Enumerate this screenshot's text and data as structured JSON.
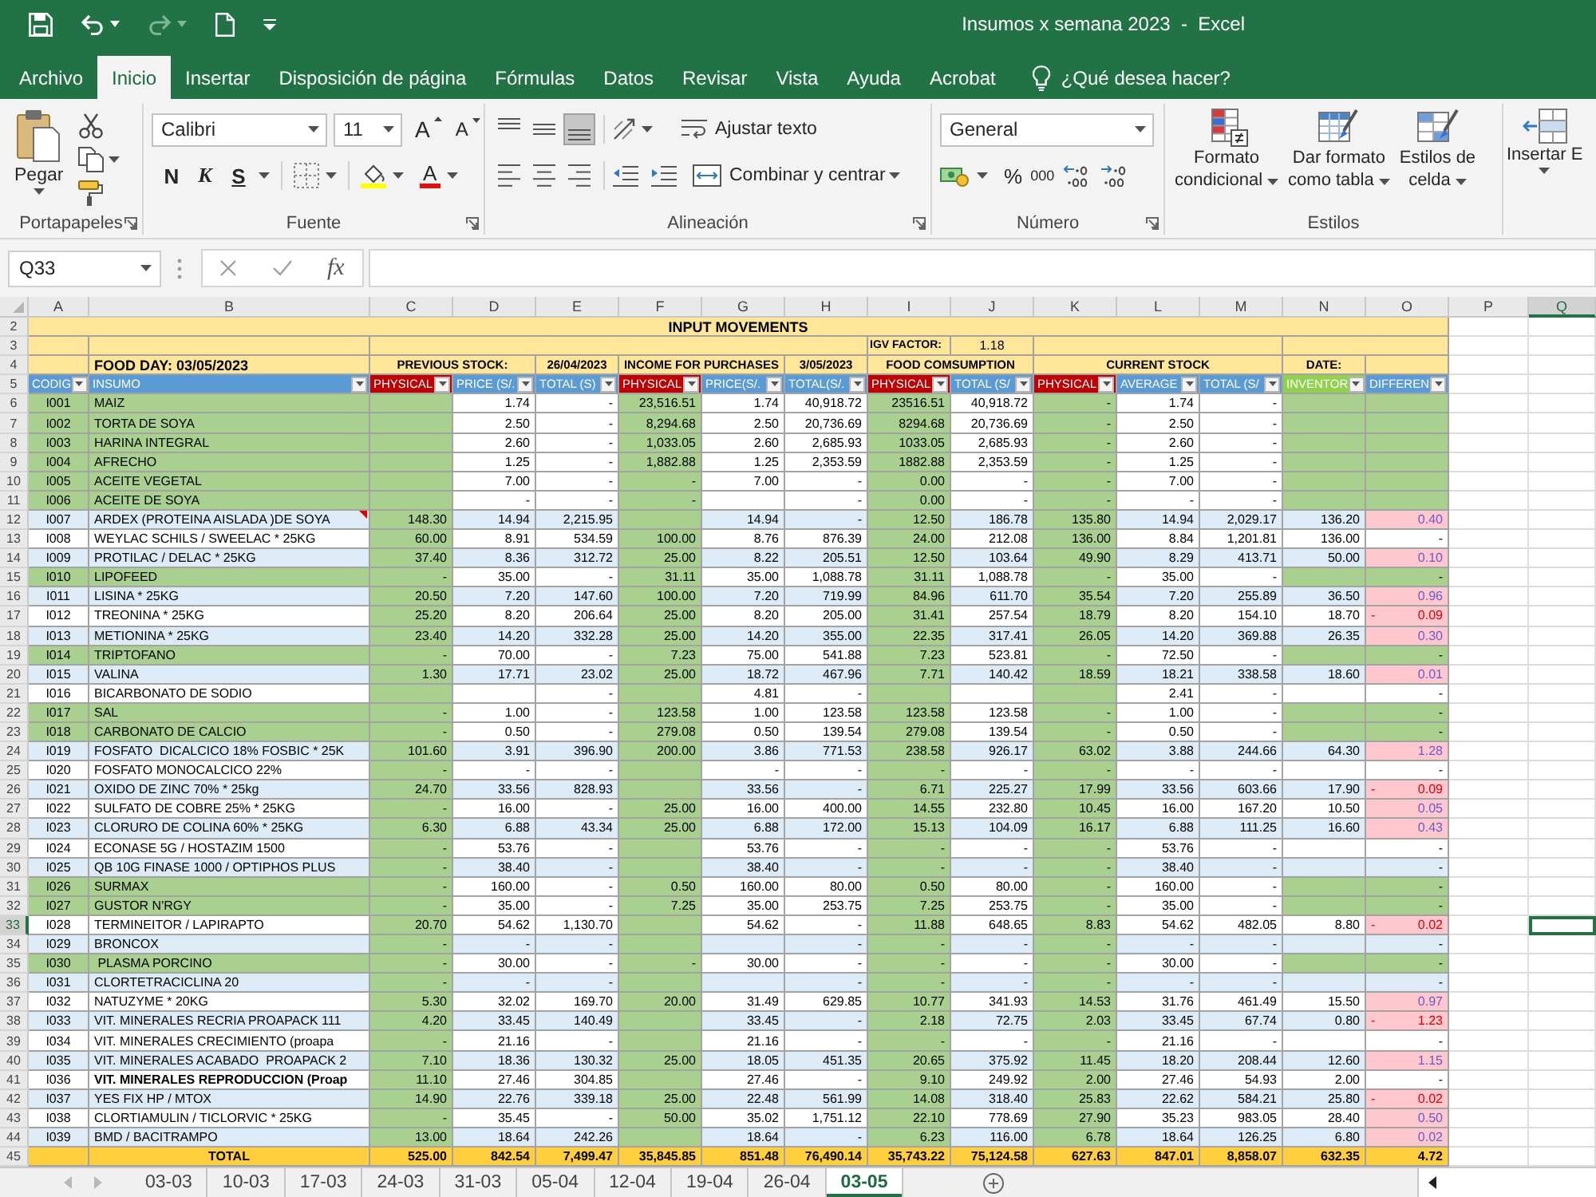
{
  "window": {
    "title": "Insumos x semana 2023  -  Excel"
  },
  "ribbon_tabs": [
    {
      "label": "Archivo",
      "selected": false
    },
    {
      "label": "Inicio",
      "selected": true
    },
    {
      "label": "Insertar",
      "selected": false
    },
    {
      "label": "Disposición de página",
      "selected": false
    },
    {
      "label": "Fórmulas",
      "selected": false
    },
    {
      "label": "Datos",
      "selected": false
    },
    {
      "label": "Revisar",
      "selected": false
    },
    {
      "label": "Vista",
      "selected": false
    },
    {
      "label": "Ayuda",
      "selected": false
    },
    {
      "label": "Acrobat",
      "selected": false
    }
  ],
  "tell_me": {
    "placeholder": "¿Qué desea hacer?"
  },
  "ribbon": {
    "clipboard": {
      "paste": "Pegar",
      "label": "Portapapeles"
    },
    "font": {
      "name": "Calibri",
      "size": "11",
      "grow_font_button": "A",
      "shrink_font_button": "A",
      "bold_button": "N",
      "italic_button": "K",
      "underline_button": "S",
      "font_color_button": "A",
      "label": "Fuente"
    },
    "alignment": {
      "vertical": [
        {
          "kind": "top",
          "selected": false
        },
        {
          "kind": "middle",
          "selected": false
        },
        {
          "kind": "bottom",
          "selected": true
        }
      ],
      "horizontal": [
        {
          "kind": "left",
          "selected": false
        },
        {
          "kind": "center",
          "selected": false
        },
        {
          "kind": "right",
          "selected": false
        }
      ],
      "wrap_text": "Ajustar texto",
      "merge": "Combinar y centrar",
      "label": "Alineación"
    },
    "number": {
      "format": "General",
      "percent": "%",
      "thousands": "000",
      "label": "Número"
    },
    "styles": {
      "buttons": [
        {
          "kind": "conditional",
          "lines": [
            "Formato",
            "condicional"
          ]
        },
        {
          "kind": "table",
          "lines": [
            "Dar formato",
            "como tabla"
          ]
        },
        {
          "kind": "cell",
          "lines": [
            "Estilos de",
            "celda"
          ]
        }
      ],
      "label": "Estilos"
    },
    "cells": {
      "insert": "Insertar E"
    }
  },
  "formula_bar": {
    "name_box": "Q33",
    "function": "fx"
  },
  "sheet": {
    "columns": [
      {
        "label": "A",
        "selected": false
      },
      {
        "label": "B",
        "selected": false
      },
      {
        "label": "C",
        "selected": false
      },
      {
        "label": "D",
        "selected": false
      },
      {
        "label": "E",
        "selected": false
      },
      {
        "label": "F",
        "selected": false
      },
      {
        "label": "G",
        "selected": false
      },
      {
        "label": "H",
        "selected": false
      },
      {
        "label": "I",
        "selected": false
      },
      {
        "label": "J",
        "selected": false
      },
      {
        "label": "K",
        "selected": false
      },
      {
        "label": "L",
        "selected": false
      },
      {
        "label": "M",
        "selected": false
      },
      {
        "label": "N",
        "selected": false
      },
      {
        "label": "O",
        "selected": false
      },
      {
        "label": "P",
        "selected": false
      },
      {
        "label": "Q",
        "selected": true
      }
    ],
    "title_row": {
      "number": "2",
      "selected": false,
      "title": "INPUT MOVEMENTS"
    },
    "factor_row": {
      "number": "3",
      "selected": false,
      "label": "IGV FACTOR:",
      "value": "1.18"
    },
    "group_row": {
      "number": "4",
      "selected": false,
      "food_day": "FOOD DAY: 03/05/2023",
      "previous_stock": "PREVIOUS STOCK:",
      "previous_date": "26/04/2023",
      "income": "INCOME FOR PURCHASES",
      "income_date": "3/05/2023",
      "consumption": "FOOD COMSUMPTION",
      "current_stock": "CURRENT STOCK",
      "date": "DATE:"
    },
    "header_row": {
      "number": "5",
      "selected": false,
      "cells": [
        {
          "label": "CODIG",
          "color": "#5b9bd5"
        },
        {
          "label": "INSUMO",
          "color": "#5b9bd5"
        },
        {
          "label": "PHYSICAL",
          "color": "#c00000"
        },
        {
          "label": "PRICE (S/.",
          "color": "#5b9bd5"
        },
        {
          "label": "TOTAL (S)",
          "color": "#5b9bd5"
        },
        {
          "label": "PHYSICAL",
          "color": "#c00000"
        },
        {
          "label": "PRICE(S/.",
          "color": "#5b9bd5"
        },
        {
          "label": "TOTAL(S/.",
          "color": "#5b9bd5"
        },
        {
          "label": "PHYSICAL",
          "color": "#c00000"
        },
        {
          "label": "TOTAL (S/",
          "color": "#5b9bd5"
        },
        {
          "label": "PHYSICAL",
          "color": "#c00000"
        },
        {
          "label": "AVERAGE",
          "color": "#5b9bd5"
        },
        {
          "label": "TOTAL (S/",
          "color": "#5b9bd5"
        },
        {
          "label": "INVENTOR",
          "color": "#92d050"
        },
        {
          "label": "DIFFEREN",
          "color": "#5b9bd5"
        }
      ]
    },
    "rows": [
      {
        "number": "6",
        "selected": false,
        "highlighted": true,
        "shaded": false,
        "comment": false,
        "bold": false,
        "flagged": false,
        "code": "I001",
        "item": "MAIZ",
        "prev_price": "1.74",
        "prev_total": "-",
        "in_qty": "23,516.51",
        "in_price": "1.74",
        "in_total": "40,918.72",
        "use_qty": "23516.51",
        "use_total": "40,918.72",
        "stock_qty": "-",
        "stock_avg": "1.74",
        "stock_total": "-"
      },
      {
        "number": "7",
        "selected": false,
        "highlighted": true,
        "shaded": false,
        "comment": false,
        "bold": false,
        "flagged": false,
        "code": "I002",
        "item": "TORTA DE SOYA",
        "prev_price": "2.50",
        "prev_total": "-",
        "in_qty": "8,294.68",
        "in_price": "2.50",
        "in_total": "20,736.69",
        "use_qty": "8294.68",
        "use_total": "20,736.69",
        "stock_qty": "-",
        "stock_avg": "2.50",
        "stock_total": "-"
      },
      {
        "number": "8",
        "selected": false,
        "highlighted": true,
        "shaded": false,
        "comment": false,
        "bold": false,
        "flagged": false,
        "code": "I003",
        "item": "HARINA INTEGRAL",
        "prev_price": "2.60",
        "prev_total": "-",
        "in_qty": "1,033.05",
        "in_price": "2.60",
        "in_total": "2,685.93",
        "use_qty": "1033.05",
        "use_total": "2,685.93",
        "stock_qty": "-",
        "stock_avg": "2.60",
        "stock_total": "-"
      },
      {
        "number": "9",
        "selected": false,
        "highlighted": true,
        "shaded": false,
        "comment": false,
        "bold": false,
        "flagged": false,
        "code": "I004",
        "item": "AFRECHO",
        "prev_price": "1.25",
        "prev_total": "-",
        "in_qty": "1,882.88",
        "in_price": "1.25",
        "in_total": "2,353.59",
        "use_qty": "1882.88",
        "use_total": "2,353.59",
        "stock_qty": "-",
        "stock_avg": "1.25",
        "stock_total": "-"
      },
      {
        "number": "10",
        "selected": false,
        "highlighted": true,
        "shaded": false,
        "comment": false,
        "bold": false,
        "flagged": false,
        "code": "I005",
        "item": "ACEITE VEGETAL",
        "prev_price": "7.00",
        "prev_total": "-",
        "in_qty": "-",
        "in_price": "7.00",
        "in_total": "-",
        "use_qty": "0.00",
        "use_total": "-",
        "stock_qty": "-",
        "stock_avg": "7.00",
        "stock_total": "-"
      },
      {
        "number": "11",
        "selected": false,
        "highlighted": true,
        "shaded": false,
        "comment": false,
        "bold": false,
        "flagged": false,
        "code": "I006",
        "item": "ACEITE DE SOYA",
        "prev_price": "-",
        "prev_total": "-",
        "in_qty": "-",
        "in_total": "-",
        "use_qty": "0.00",
        "use_total": "-",
        "stock_qty": "-",
        "stock_avg": "-",
        "stock_total": "-"
      },
      {
        "number": "12",
        "selected": false,
        "highlighted": false,
        "shaded": true,
        "comment": true,
        "bold": false,
        "flagged": true,
        "code": "I007",
        "item": "ARDEX (PROTEINA AISLADA )DE SOYA",
        "prev_qty": "148.30",
        "prev_price": "14.94",
        "prev_total": "2,215.95",
        "in_price": "14.94",
        "in_total": "-",
        "use_qty": "12.50",
        "use_total": "186.78",
        "stock_qty": "135.80",
        "stock_avg": "14.94",
        "stock_total": "2,029.17",
        "inventory": "136.20",
        "difference": "0.40"
      },
      {
        "number": "13",
        "selected": false,
        "highlighted": false,
        "shaded": false,
        "comment": false,
        "bold": false,
        "flagged": false,
        "code": "I008",
        "item": "WEYLAC SCHILS / SWEELAC * 25KG",
        "prev_qty": "60.00",
        "prev_price": "8.91",
        "prev_total": "534.59",
        "in_qty": "100.00",
        "in_price": "8.76",
        "in_total": "876.39",
        "use_qty": "24.00",
        "use_total": "212.08",
        "stock_qty": "136.00",
        "stock_avg": "8.84",
        "stock_total": "1,201.81",
        "inventory": "136.00",
        "difference": "-"
      },
      {
        "number": "14",
        "selected": false,
        "highlighted": false,
        "shaded": true,
        "comment": false,
        "bold": false,
        "flagged": true,
        "code": "I009",
        "item": "PROTILAC / DELAC * 25KG",
        "prev_qty": "37.40",
        "prev_price": "8.36",
        "prev_total": "312.72",
        "in_qty": "25.00",
        "in_price": "8.22",
        "in_total": "205.51",
        "use_qty": "12.50",
        "use_total": "103.64",
        "stock_qty": "49.90",
        "stock_avg": "8.29",
        "stock_total": "413.71",
        "inventory": "50.00",
        "difference": "0.10"
      },
      {
        "number": "15",
        "selected": false,
        "highlighted": true,
        "shaded": false,
        "comment": false,
        "bold": false,
        "flagged": false,
        "code": "I010",
        "item": "LIPOFEED",
        "prev_qty": "-",
        "prev_price": "35.00",
        "prev_total": "-",
        "in_qty": "31.11",
        "in_price": "35.00",
        "in_total": "1,088.78",
        "use_qty": "31.11",
        "use_total": "1,088.78",
        "stock_qty": "-",
        "stock_avg": "35.00",
        "stock_total": "-",
        "difference": "-"
      },
      {
        "number": "16",
        "selected": false,
        "highlighted": false,
        "shaded": true,
        "comment": false,
        "bold": false,
        "flagged": true,
        "code": "I011",
        "item": "LISINA * 25KG",
        "prev_qty": "20.50",
        "prev_price": "7.20",
        "prev_total": "147.60",
        "in_qty": "100.00",
        "in_price": "7.20",
        "in_total": "719.99",
        "use_qty": "84.96",
        "use_total": "611.70",
        "stock_qty": "35.54",
        "stock_avg": "7.20",
        "stock_total": "255.89",
        "inventory": "36.50",
        "difference": "0.96"
      },
      {
        "number": "17",
        "selected": false,
        "highlighted": false,
        "shaded": false,
        "comment": false,
        "bold": false,
        "flagged": true,
        "code": "I012",
        "item": "TREONINA * 25KG",
        "prev_qty": "25.20",
        "prev_price": "8.20",
        "prev_total": "206.64",
        "in_qty": "25.00",
        "in_price": "8.20",
        "in_total": "205.00",
        "use_qty": "31.41",
        "use_total": "257.54",
        "stock_qty": "18.79",
        "stock_avg": "8.20",
        "stock_total": "154.10",
        "inventory": "18.70",
        "difference_sign": "-",
        "difference": "0.09"
      },
      {
        "number": "18",
        "selected": false,
        "highlighted": false,
        "shaded": true,
        "comment": false,
        "bold": false,
        "flagged": true,
        "code": "I013",
        "item": "METIONINA * 25KG",
        "prev_qty": "23.40",
        "prev_price": "14.20",
        "prev_total": "332.28",
        "in_qty": "25.00",
        "in_price": "14.20",
        "in_total": "355.00",
        "use_qty": "22.35",
        "use_total": "317.41",
        "stock_qty": "26.05",
        "stock_avg": "14.20",
        "stock_total": "369.88",
        "inventory": "26.35",
        "difference": "0.30"
      },
      {
        "number": "19",
        "selected": false,
        "highlighted": true,
        "shaded": false,
        "comment": false,
        "bold": false,
        "flagged": false,
        "code": "I014",
        "item": "TRIPTOFANO",
        "prev_qty": "-",
        "prev_price": "70.00",
        "prev_total": "-",
        "in_qty": "7.23",
        "in_price": "75.00",
        "in_total": "541.88",
        "use_qty": "7.23",
        "use_total": "523.81",
        "stock_qty": "-",
        "stock_avg": "72.50",
        "stock_total": "-",
        "difference": "-"
      },
      {
        "number": "20",
        "selected": false,
        "highlighted": false,
        "shaded": true,
        "comment": false,
        "bold": false,
        "flagged": true,
        "code": "I015",
        "item": "VALINA",
        "prev_qty": "1.30",
        "prev_price": "17.71",
        "prev_total": "23.02",
        "in_qty": "25.00",
        "in_price": "18.72",
        "in_total": "467.96",
        "use_qty": "7.71",
        "use_total": "140.42",
        "stock_qty": "18.59",
        "stock_avg": "18.21",
        "stock_total": "338.58",
        "inventory": "18.60",
        "difference": "0.01"
      },
      {
        "number": "21",
        "selected": false,
        "highlighted": false,
        "shaded": false,
        "comment": false,
        "bold": false,
        "flagged": false,
        "code": "I016",
        "item": "BICARBONATO DE SODIO",
        "prev_total": "-",
        "in_price": "4.81",
        "in_total": "-",
        "stock_avg": "2.41",
        "stock_total": "-",
        "difference": "-"
      },
      {
        "number": "22",
        "selected": false,
        "highlighted": true,
        "shaded": false,
        "comment": false,
        "bold": false,
        "flagged": false,
        "code": "I017",
        "item": "SAL",
        "prev_qty": "-",
        "prev_price": "1.00",
        "prev_total": "-",
        "in_qty": "123.58",
        "in_price": "1.00",
        "in_total": "123.58",
        "use_qty": "123.58",
        "use_total": "123.58",
        "stock_qty": "-",
        "stock_avg": "1.00",
        "stock_total": "-",
        "difference": "-"
      },
      {
        "number": "23",
        "selected": false,
        "highlighted": true,
        "shaded": false,
        "comment": false,
        "bold": false,
        "flagged": false,
        "code": "I018",
        "item": "CARBONATO DE CALCIO",
        "prev_qty": "-",
        "prev_price": "0.50",
        "prev_total": "-",
        "in_qty": "279.08",
        "in_price": "0.50",
        "in_total": "139.54",
        "use_qty": "279.08",
        "use_total": "139.54",
        "stock_qty": "-",
        "stock_avg": "0.50",
        "stock_total": "-",
        "difference": "-"
      },
      {
        "number": "24",
        "selected": false,
        "highlighted": false,
        "shaded": true,
        "comment": false,
        "bold": false,
        "flagged": true,
        "code": "I019",
        "item": "FOSFATO  DICALCICO 18% FOSBIC * 25K",
        "prev_qty": "101.60",
        "prev_price": "3.91",
        "prev_total": "396.90",
        "in_qty": "200.00",
        "in_price": "3.86",
        "in_total": "771.53",
        "use_qty": "238.58",
        "use_total": "926.17",
        "stock_qty": "63.02",
        "stock_avg": "3.88",
        "stock_total": "244.66",
        "inventory": "64.30",
        "difference": "1.28"
      },
      {
        "number": "25",
        "selected": false,
        "highlighted": false,
        "shaded": false,
        "comment": false,
        "bold": false,
        "flagged": false,
        "code": "I020",
        "item": "FOSFATO MONOCALCICO 22%",
        "prev_qty": "-",
        "prev_price": "-",
        "prev_total": "-",
        "in_price": "-",
        "in_total": "-",
        "use_qty": "-",
        "use_total": "-",
        "stock_qty": "-",
        "stock_avg": "-",
        "stock_total": "-",
        "difference": "-"
      },
      {
        "number": "26",
        "selected": false,
        "highlighted": false,
        "shaded": true,
        "comment": false,
        "bold": false,
        "flagged": true,
        "code": "I021",
        "item": "OXIDO DE ZINC 70% * 25kg",
        "prev_qty": "24.70",
        "prev_price": "33.56",
        "prev_total": "828.93",
        "in_price": "33.56",
        "in_total": "-",
        "use_qty": "6.71",
        "use_total": "225.27",
        "stock_qty": "17.99",
        "stock_avg": "33.56",
        "stock_total": "603.66",
        "inventory": "17.90",
        "difference_sign": "-",
        "difference": "0.09"
      },
      {
        "number": "27",
        "selected": false,
        "highlighted": false,
        "shaded": false,
        "comment": false,
        "bold": false,
        "flagged": true,
        "code": "I022",
        "item": "SULFATO DE COBRE 25% * 25KG",
        "prev_qty": "-",
        "prev_price": "16.00",
        "prev_total": "-",
        "in_qty": "25.00",
        "in_price": "16.00",
        "in_total": "400.00",
        "use_qty": "14.55",
        "use_total": "232.80",
        "stock_qty": "10.45",
        "stock_avg": "16.00",
        "stock_total": "167.20",
        "inventory": "10.50",
        "difference": "0.05"
      },
      {
        "number": "28",
        "selected": false,
        "highlighted": false,
        "shaded": true,
        "comment": false,
        "bold": false,
        "flagged": true,
        "code": "I023",
        "item": "CLORURO DE COLINA 60% * 25KG",
        "prev_qty": "6.30",
        "prev_price": "6.88",
        "prev_total": "43.34",
        "in_qty": "25.00",
        "in_price": "6.88",
        "in_total": "172.00",
        "use_qty": "15.13",
        "use_total": "104.09",
        "stock_qty": "16.17",
        "stock_avg": "6.88",
        "stock_total": "111.25",
        "inventory": "16.60",
        "difference": "0.43"
      },
      {
        "number": "29",
        "selected": false,
        "highlighted": false,
        "shaded": false,
        "comment": false,
        "bold": false,
        "flagged": false,
        "code": "I024",
        "item": "ECONASE 5G / HOSTAZIM 1500",
        "prev_qty": "-",
        "prev_price": "53.76",
        "prev_total": "-",
        "in_price": "53.76",
        "in_total": "-",
        "use_qty": "-",
        "use_total": "-",
        "stock_qty": "-",
        "stock_avg": "53.76",
        "stock_total": "-",
        "difference": "-"
      },
      {
        "number": "30",
        "selected": false,
        "highlighted": false,
        "shaded": true,
        "comment": false,
        "bold": false,
        "flagged": false,
        "code": "I025",
        "item": "QB 10G FINASE 1000 / OPTIPHOS PLUS",
        "prev_qty": "-",
        "prev_price": "38.40",
        "prev_total": "-",
        "in_price": "38.40",
        "in_total": "-",
        "use_qty": "-",
        "use_total": "-",
        "stock_qty": "-",
        "stock_avg": "38.40",
        "stock_total": "-",
        "difference": "-"
      },
      {
        "number": "31",
        "selected": false,
        "highlighted": true,
        "shaded": false,
        "comment": false,
        "bold": false,
        "flagged": false,
        "code": "I026",
        "item": "SURMAX",
        "prev_qty": "-",
        "prev_price": "160.00",
        "prev_total": "-",
        "in_qty": "0.50",
        "in_price": "160.00",
        "in_total": "80.00",
        "use_qty": "0.50",
        "use_total": "80.00",
        "stock_qty": "-",
        "stock_avg": "160.00",
        "stock_total": "-",
        "difference": "-"
      },
      {
        "number": "32",
        "selected": false,
        "highlighted": true,
        "shaded": false,
        "comment": false,
        "bold": false,
        "flagged": false,
        "code": "I027",
        "item": "GUSTOR N'RGY",
        "prev_qty": "-",
        "prev_price": "35.00",
        "prev_total": "-",
        "in_qty": "7.25",
        "in_price": "35.00",
        "in_total": "253.75",
        "use_qty": "7.25",
        "use_total": "253.75",
        "stock_qty": "-",
        "stock_avg": "35.00",
        "stock_total": "-",
        "difference": "-"
      },
      {
        "number": "33",
        "selected": true,
        "highlighted": false,
        "shaded": false,
        "comment": false,
        "bold": false,
        "flagged": true,
        "code": "I028",
        "item": "TERMINEITOR / LAPIRAPTO",
        "prev_qty": "20.70",
        "prev_price": "54.62",
        "prev_total": "1,130.70",
        "in_price": "54.62",
        "in_total": "-",
        "use_qty": "11.88",
        "use_total": "648.65",
        "stock_qty": "8.83",
        "stock_avg": "54.62",
        "stock_total": "482.05",
        "inventory": "8.80",
        "difference_sign": "-",
        "difference": "0.02"
      },
      {
        "number": "34",
        "selected": false,
        "highlighted": false,
        "shaded": true,
        "comment": false,
        "bold": false,
        "flagged": false,
        "code": "I029",
        "item": "BRONCOX",
        "prev_qty": "-",
        "prev_price": "-",
        "prev_total": "-",
        "in_total": "-",
        "use_qty": "-",
        "use_total": "-",
        "stock_qty": "-",
        "stock_avg": "-",
        "stock_total": "-",
        "difference": "-"
      },
      {
        "number": "35",
        "selected": false,
        "highlighted": true,
        "shaded": false,
        "comment": false,
        "bold": false,
        "flagged": false,
        "code": "I030",
        "item": " PLASMA PORCINO",
        "prev_qty": "-",
        "prev_price": "30.00",
        "prev_total": "-",
        "in_qty": "-",
        "in_price": "30.00",
        "in_total": "-",
        "use_qty": "-",
        "use_total": "-",
        "stock_qty": "-",
        "stock_avg": "30.00",
        "stock_total": "-",
        "difference": "-"
      },
      {
        "number": "36",
        "selected": false,
        "highlighted": false,
        "shaded": true,
        "comment": false,
        "bold": false,
        "flagged": false,
        "code": "I031",
        "item": "CLORTETRACICLINA 20",
        "prev_qty": "-",
        "prev_price": "-",
        "prev_total": "-",
        "in_total": "-",
        "use_qty": "-",
        "use_total": "-",
        "stock_qty": "-",
        "stock_avg": "-",
        "stock_total": "-",
        "difference": "-"
      },
      {
        "number": "37",
        "selected": false,
        "highlighted": false,
        "shaded": false,
        "comment": false,
        "bold": false,
        "flagged": true,
        "code": "I032",
        "item": "NATUZYME * 20KG",
        "prev_qty": "5.30",
        "prev_price": "32.02",
        "prev_total": "169.70",
        "in_qty": "20.00",
        "in_price": "31.49",
        "in_total": "629.85",
        "use_qty": "10.77",
        "use_total": "341.93",
        "stock_qty": "14.53",
        "stock_avg": "31.76",
        "stock_total": "461.49",
        "inventory": "15.50",
        "difference": "0.97"
      },
      {
        "number": "38",
        "selected": false,
        "highlighted": false,
        "shaded": true,
        "comment": false,
        "bold": false,
        "flagged": true,
        "code": "I033",
        "item": "VIT. MINERALES RECRIA PROAPACK 111",
        "prev_qty": "4.20",
        "prev_price": "33.45",
        "prev_total": "140.49",
        "in_price": "33.45",
        "in_total": "-",
        "use_qty": "2.18",
        "use_total": "72.75",
        "stock_qty": "2.03",
        "stock_avg": "33.45",
        "stock_total": "67.74",
        "inventory": "0.80",
        "difference_sign": "-",
        "difference": "1.23"
      },
      {
        "number": "39",
        "selected": false,
        "highlighted": false,
        "shaded": false,
        "comment": false,
        "bold": false,
        "flagged": false,
        "code": "I034",
        "item": "VIT. MINERALES CRECIMIENTO (proapa",
        "prev_qty": "-",
        "prev_price": "21.16",
        "prev_total": "-",
        "in_price": "21.16",
        "in_total": "-",
        "use_qty": "-",
        "use_total": "-",
        "stock_qty": "-",
        "stock_avg": "21.16",
        "stock_total": "-",
        "difference": "-"
      },
      {
        "number": "40",
        "selected": false,
        "highlighted": false,
        "shaded": true,
        "comment": false,
        "bold": false,
        "flagged": true,
        "code": "I035",
        "item": "VIT. MINERALES ACABADO  PROAPACK 2",
        "prev_qty": "7.10",
        "prev_price": "18.36",
        "prev_total": "130.32",
        "in_qty": "25.00",
        "in_price": "18.05",
        "in_total": "451.35",
        "use_qty": "20.65",
        "use_total": "375.92",
        "stock_qty": "11.45",
        "stock_avg": "18.20",
        "stock_total": "208.44",
        "inventory": "12.60",
        "difference": "1.15"
      },
      {
        "number": "41",
        "selected": false,
        "highlighted": false,
        "shaded": false,
        "comment": false,
        "bold": true,
        "flagged": false,
        "code": "I036",
        "item": "VIT. MINERALES REPRODUCCION (Proap",
        "prev_qty": "11.10",
        "prev_price": "27.46",
        "prev_total": "304.85",
        "in_price": "27.46",
        "in_total": "-",
        "use_qty": "9.10",
        "use_total": "249.92",
        "stock_qty": "2.00",
        "stock_avg": "27.46",
        "stock_total": "54.93",
        "inventory": "2.00",
        "difference": "-"
      },
      {
        "number": "42",
        "selected": false,
        "highlighted": false,
        "shaded": true,
        "comment": false,
        "bold": false,
        "flagged": true,
        "code": "I037",
        "item": "YES FIX HP / MTOX",
        "prev_qty": "14.90",
        "prev_price": "22.76",
        "prev_total": "339.18",
        "in_qty": "25.00",
        "in_price": "22.48",
        "in_total": "561.99",
        "use_qty": "14.08",
        "use_total": "318.40",
        "stock_qty": "25.83",
        "stock_avg": "22.62",
        "stock_total": "584.21",
        "inventory": "25.80",
        "difference_sign": "-",
        "difference": "0.02"
      },
      {
        "number": "43",
        "selected": false,
        "highlighted": false,
        "shaded": false,
        "comment": false,
        "bold": false,
        "flagged": true,
        "code": "I038",
        "item": "CLORTIAMULIN / TICLORVIC * 25KG",
        "prev_qty": "-",
        "prev_price": "35.45",
        "prev_total": "-",
        "in_qty": "50.00",
        "in_price": "35.02",
        "in_total": "1,751.12",
        "use_qty": "22.10",
        "use_total": "778.69",
        "stock_qty": "27.90",
        "stock_avg": "35.23",
        "stock_total": "983.05",
        "inventory": "28.40",
        "difference": "0.50"
      },
      {
        "number": "44",
        "selected": false,
        "highlighted": false,
        "shaded": true,
        "comment": false,
        "bold": false,
        "flagged": true,
        "code": "I039",
        "item": "BMD / BACITRAMPO",
        "prev_qty": "13.00",
        "prev_price": "18.64",
        "prev_total": "242.26",
        "in_price": "18.64",
        "in_total": "-",
        "use_qty": "6.23",
        "use_total": "116.00",
        "stock_qty": "6.78",
        "stock_avg": "18.64",
        "stock_total": "126.25",
        "inventory": "6.80",
        "difference": "0.02"
      }
    ],
    "total_row": {
      "number": "45",
      "selected": false,
      "label": "TOTAL",
      "prev_qty": "525.00",
      "prev_price": "842.54",
      "prev_total": "7,499.47",
      "in_qty": "35,845.85",
      "in_price": "851.48",
      "in_total": "76,490.14",
      "use_qty": "35,743.22",
      "use_total": "75,124.58",
      "stock_qty": "627.63",
      "stock_avg": "847.01",
      "stock_total": "8,858.07",
      "inventory": "632.35",
      "difference": "4.72"
    }
  },
  "sheet_tabs": [
    {
      "label": "03-03",
      "selected": false
    },
    {
      "label": "10-03",
      "selected": false
    },
    {
      "label": "17-03",
      "selected": false
    },
    {
      "label": "24-03",
      "selected": false
    },
    {
      "label": "31-03",
      "selected": false
    },
    {
      "label": "05-04",
      "selected": false
    },
    {
      "label": "12-04",
      "selected": false
    },
    {
      "label": "19-04",
      "selected": false
    },
    {
      "label": "26-04",
      "selected": false
    },
    {
      "label": "03-05",
      "selected": true
    }
  ]
}
